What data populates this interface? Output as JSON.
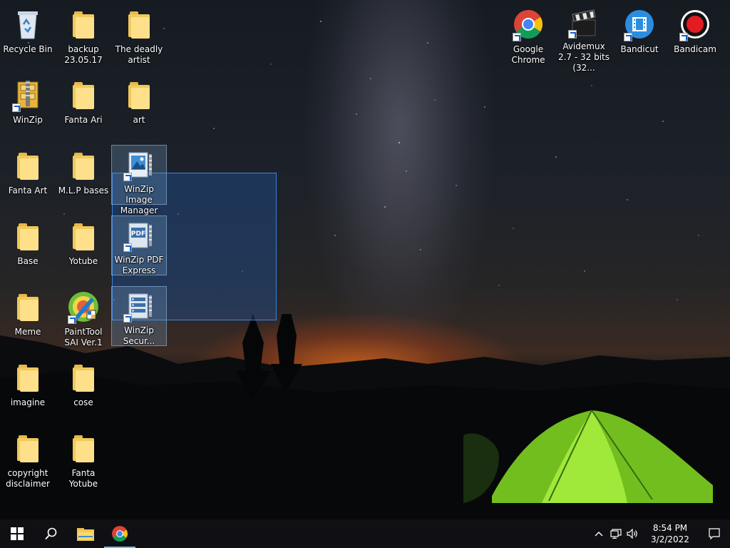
{
  "desktop": {
    "icons": [
      {
        "id": "recycle-bin",
        "label": "Recycle Bin",
        "kind": "recycle"
      },
      {
        "id": "backup",
        "label": "backup 23.05.17",
        "kind": "folder"
      },
      {
        "id": "deadly-artist",
        "label": "The deadly artist",
        "kind": "folder"
      },
      {
        "id": "winzip",
        "label": "WinZip",
        "kind": "winzip"
      },
      {
        "id": "fanta-ari",
        "label": "Fanta Ari",
        "kind": "folder"
      },
      {
        "id": "art",
        "label": "art",
        "kind": "folder"
      },
      {
        "id": "fanta-art",
        "label": "Fanta Art",
        "kind": "folder"
      },
      {
        "id": "mlp-bases",
        "label": "M.L.P bases",
        "kind": "folder"
      },
      {
        "id": "winzip-image-manager",
        "label": "WinZip Image Manager",
        "kind": "winzip-image",
        "selected": true
      },
      {
        "id": "base",
        "label": "Base",
        "kind": "folder"
      },
      {
        "id": "yotube",
        "label": "Yotube",
        "kind": "folder"
      },
      {
        "id": "winzip-pdf-express",
        "label": "WinZip PDF Express",
        "kind": "winzip-pdf",
        "selected": true
      },
      {
        "id": "meme",
        "label": "Meme",
        "kind": "folder"
      },
      {
        "id": "painttool-sai",
        "label": "PaintTool SAI Ver.1",
        "kind": "sai"
      },
      {
        "id": "winzip-secure",
        "label": "WinZip Secur...",
        "kind": "winzip-secure",
        "selected": true
      },
      {
        "id": "imagine",
        "label": "imagine",
        "kind": "folder"
      },
      {
        "id": "cose",
        "label": "cose",
        "kind": "folder"
      },
      {
        "id": "copyright-disclaimer",
        "label": "copyright disclaimer",
        "kind": "folder"
      },
      {
        "id": "fanta-yotube",
        "label": "Fanta Yotube",
        "kind": "folder"
      },
      {
        "id": "google-chrome",
        "label": "Google Chrome",
        "kind": "chrome"
      },
      {
        "id": "avidemux",
        "label": "Avidemux 2.7 - 32 bits (32...",
        "kind": "avidemux"
      },
      {
        "id": "bandicut",
        "label": "Bandicut",
        "kind": "bandicut"
      },
      {
        "id": "bandicam",
        "label": "Bandicam",
        "kind": "bandicam"
      }
    ]
  },
  "taskbar": {
    "start_icon": "windows-start-icon",
    "search_icon": "search-icon",
    "pinned": [
      {
        "name": "file-explorer",
        "icon": "folder-icon"
      },
      {
        "name": "google-chrome",
        "icon": "chrome-icon",
        "active": true
      }
    ],
    "tray": {
      "chevron": "^",
      "time": "8:54 PM",
      "date": "3/2/2022"
    }
  },
  "colors": {
    "folder": "#f0c95c",
    "selection": "#1e64c8",
    "taskbar": "#101014",
    "chrome_red": "#db4437",
    "chrome_yellow": "#f4c20d",
    "chrome_green": "#0f9d58",
    "chrome_blue": "#4285f4"
  }
}
